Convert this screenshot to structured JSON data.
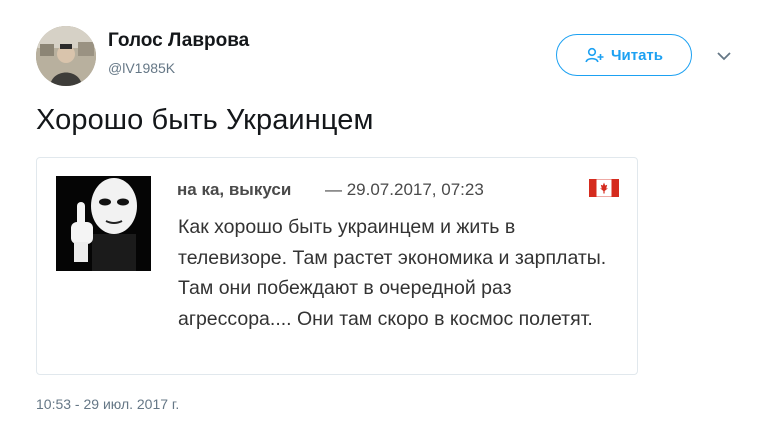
{
  "account": {
    "display_name": "Голос Лаврова",
    "handle": "@lV1985K"
  },
  "follow_button": {
    "label": "Читать"
  },
  "tweet": {
    "text": "Хорошо быть Украинцем",
    "timestamp": "10:53 - 29 июл. 2017 г."
  },
  "embedded_post": {
    "author": "на ка, выкуси",
    "date": "— 29.07.2017, 07:23",
    "text": "Как хорошо быть украинцем и жить в телевизоре. Там растет экономика и зарплаты. Там они побеждают в очередной раз агрессора.... Они там скоро в космос полетят.",
    "flag_icon": "canada-flag-icon"
  },
  "colors": {
    "accent": "#1da1f2",
    "text": "#14171a",
    "muted": "#657786",
    "flag_red": "#d52b1e"
  }
}
